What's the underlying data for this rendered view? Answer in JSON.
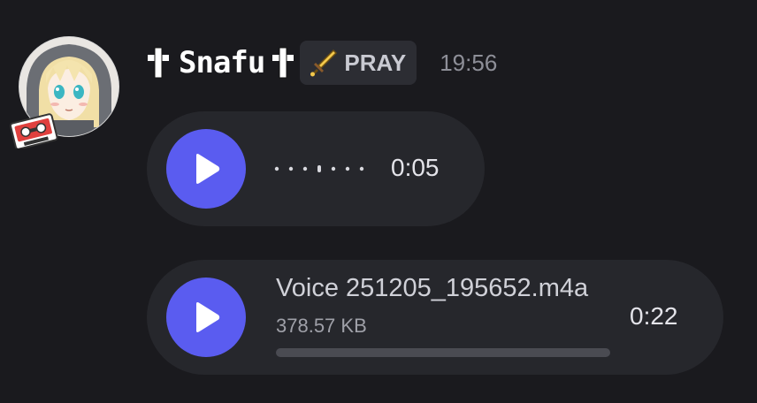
{
  "message": {
    "username": "Snafu",
    "username_decoration_icon": "latin-cross-icon",
    "role_tag": {
      "icon": "sword-icon",
      "label": "PRAY"
    },
    "timestamp": "19:56",
    "avatar_icon": "anime-avatar",
    "avatar_badge_icon": "cassette-tape-icon"
  },
  "voice_message": {
    "play_icon": "play-icon",
    "duration": "0:05",
    "accent_color": "#5a5cf0"
  },
  "audio_attachment": {
    "play_icon": "play-icon",
    "file_name": "Voice 251205_195652.m4a",
    "file_size": "378.57 KB",
    "duration": "0:22",
    "progress": 0
  },
  "colors": {
    "background": "#1a1a1e",
    "bubble": "#26272c",
    "play_button": "#5a5cf0",
    "role_tag_bg": "#2c2d33",
    "timestamp": "#8e8f98"
  }
}
